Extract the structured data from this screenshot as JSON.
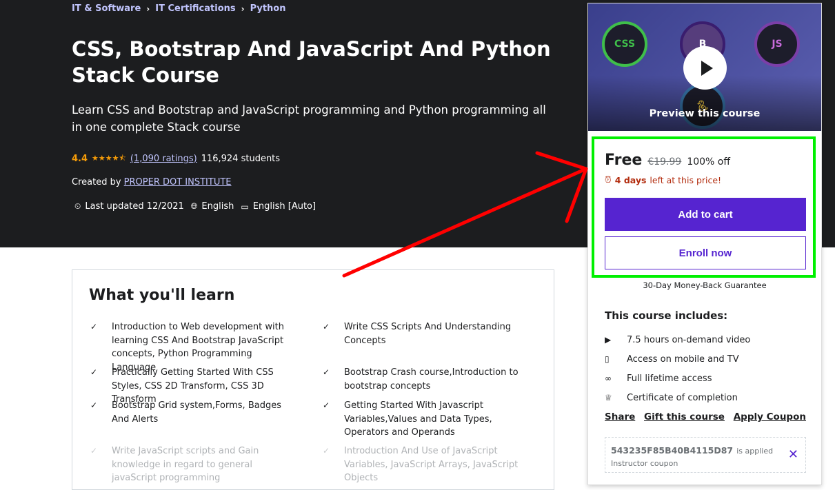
{
  "breadcrumb": [
    "IT & Software",
    "IT Certifications",
    "Python"
  ],
  "course": {
    "title": "CSS, Bootstrap And JavaScript And Python Stack Course",
    "subtitle": "Learn CSS and Bootstrap and JavaScript programming and Python programming all in one complete Stack course",
    "rating": "4.4",
    "rating_stars": 4.4,
    "ratings_count": "(1,090 ratings)",
    "students": "116,924 students",
    "created_by_label": "Created by",
    "instructor": "PROPER DOT INSTITUTE",
    "last_updated": "Last updated 12/2021",
    "language": "English",
    "captions": "English [Auto]"
  },
  "card": {
    "preview_label": "Preview this course",
    "logos": [
      "CSS",
      "B",
      "JS"
    ],
    "price": "Free",
    "original_price": "€19.99",
    "discount": "100% off",
    "timer_bold": "4 days",
    "timer_rest": "left at this price!",
    "add_to_cart": "Add to cart",
    "enroll_now": "Enroll now",
    "guarantee": "30-Day Money-Back Guarantee",
    "includes_title": "This course includes:",
    "includes": [
      {
        "icon": "video-icon",
        "glyph": "▶",
        "text": "7.5 hours on-demand video"
      },
      {
        "icon": "mobile-icon",
        "glyph": "▯",
        "text": "Access on mobile and TV"
      },
      {
        "icon": "infinity-icon",
        "glyph": "∞",
        "text": "Full lifetime access"
      },
      {
        "icon": "trophy-icon",
        "glyph": "♕",
        "text": "Certificate of completion"
      }
    ],
    "links": [
      "Share",
      "Gift this course",
      "Apply Coupon"
    ],
    "coupon_code": "543235F85B40B4115D87",
    "coupon_applied": "is applied",
    "coupon_sub": "Instructor coupon"
  },
  "learn": {
    "title": "What you'll learn",
    "items": [
      "Introduction to Web development with learning CSS And Bootstrap JavaScript concepts, Python Programming Language",
      "Write CSS Scripts And Understanding Concepts",
      "Practically Getting Started With CSS Styles, CSS 2D Transform, CSS 3D Transform",
      "Bootstrap Crash course,Introduction to bootstrap concepts",
      "Bootstrap Grid system,Forms, Badges And Alerts",
      "Getting Started With Javascript Variables,Values and Data Types, Operators and Operands",
      "Write JavaScript scripts and Gain knowledge in regard to general javaScript programming",
      "Introduction And Use of JavaScript Variables, JavaScript Arrays, JavaScript Objects"
    ]
  },
  "colors": {
    "accent": "#5624d0",
    "hero_bg": "#1c1d1f",
    "link": "#c0c4fc",
    "star": "#f69c08",
    "highlight": "#00f000",
    "annotation_arrow": "#ff0000"
  }
}
